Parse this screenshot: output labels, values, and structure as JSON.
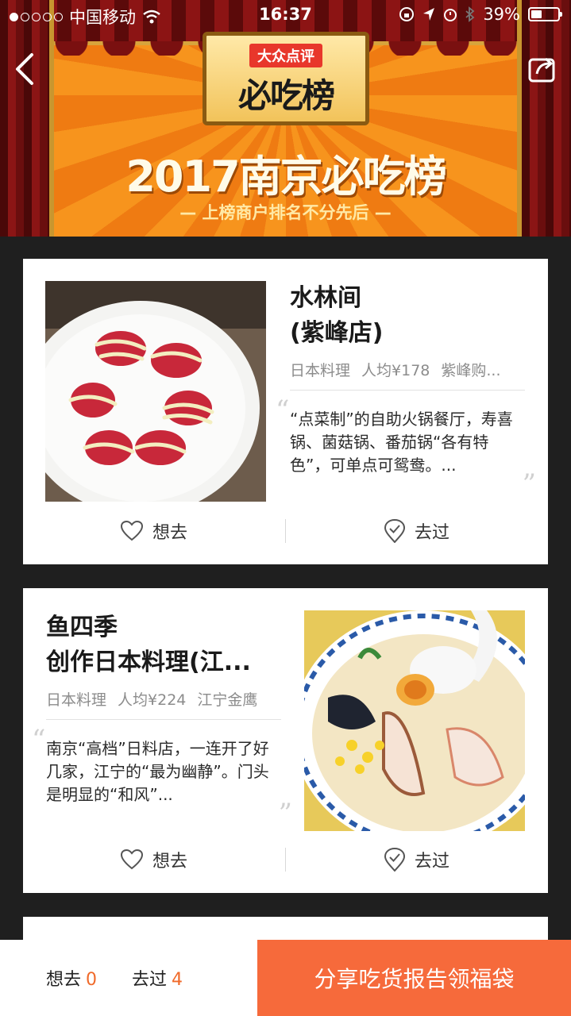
{
  "status_bar": {
    "carrier": "中国移动",
    "time": "16:37",
    "battery": "39%"
  },
  "banner": {
    "brand": "大众点评",
    "plaque_title": "必吃榜",
    "title": "2017南京必吃榜",
    "subtitle": "— 上榜商户排名不分先后 —"
  },
  "restaurants": [
    {
      "name_line1": "水林间",
      "name_line2": "(紫峰店)",
      "cuisine": "日本料理",
      "avg_price": "人均¥178",
      "area": "紫峰购...",
      "review": "“点菜制”的自助火锅餐厅，寿喜锅、菌菇锅、番茄锅“各有特色”，可单点可鸳鸯。...",
      "want_label": "想去",
      "been_label": "去过"
    },
    {
      "name_line1": "鱼四季",
      "name_line2": "创作日本料理(江...",
      "cuisine": "日本料理",
      "avg_price": "人均¥224",
      "area": "江宁金鹰",
      "review": "南京“高档”日料店，一连开了好几家，江宁的“最为幽静”。门头是明显的“和风”...",
      "want_label": "想去",
      "been_label": "去过"
    }
  ],
  "bottom_bar": {
    "want_label": "想去",
    "want_count": "0",
    "been_label": "去过",
    "been_count": "4",
    "cta": "分享吃货报告领福袋"
  }
}
